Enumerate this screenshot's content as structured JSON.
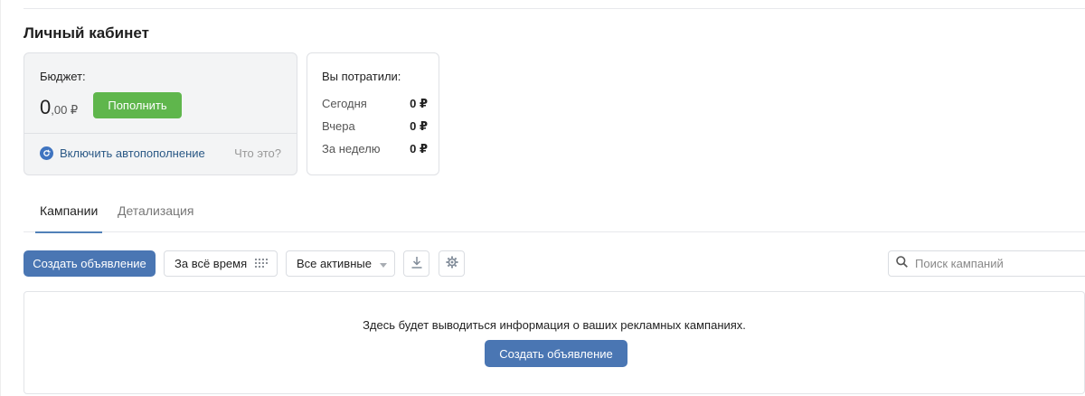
{
  "page": {
    "title": "Личный кабинет"
  },
  "budget": {
    "label": "Бюджет:",
    "amount_main": "0",
    "amount_sub": ",00 ₽",
    "topup_label": "Пополнить",
    "autofill_label": "Включить автопополнение",
    "what_label": "Что это?"
  },
  "spend": {
    "title": "Вы потратили:",
    "rows": [
      {
        "label": "Сегодня",
        "value": "0 ₽"
      },
      {
        "label": "Вчера",
        "value": "0 ₽"
      },
      {
        "label": "За неделю",
        "value": "0 ₽"
      }
    ]
  },
  "tabs": [
    {
      "label": "Кампании",
      "active": true
    },
    {
      "label": "Детализация",
      "active": false
    }
  ],
  "toolbar": {
    "create_label": "Создать объявление",
    "period_label": "За всё время",
    "status_label": "Все активные",
    "download_icon": "download-icon",
    "settings_icon": "gear-icon"
  },
  "search": {
    "placeholder": "Поиск кампаний",
    "value": ""
  },
  "empty": {
    "text": "Здесь будет выводиться информация о ваших рекламных кампаниях.",
    "create_label": "Создать объявление"
  },
  "colors": {
    "accent": "#4a76b3",
    "success": "#5fb64c",
    "link": "#2a5885",
    "tab_underline": "#5181b8"
  }
}
